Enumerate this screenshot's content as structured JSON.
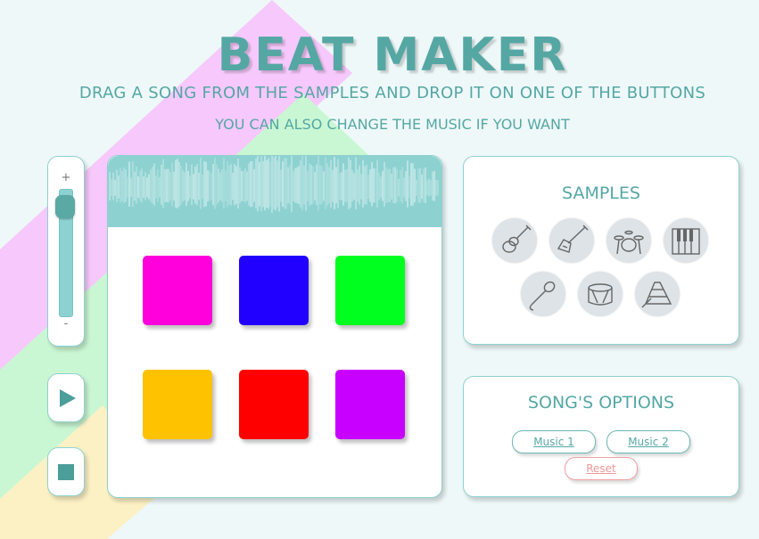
{
  "header": {
    "title": "BEAT MAKER",
    "subtitle": "DRAG A SONG FROM THE SAMPLES AND DROP IT ON ONE OF THE BUTTONS",
    "subtitle2": "YOU CAN ALSO CHANGE THE MUSIC IF YOU WANT"
  },
  "volume": {
    "plus": "+",
    "minus": "-",
    "level": 0.92
  },
  "controls": {
    "play_icon": "play-icon",
    "stop_icon": "stop-icon"
  },
  "pads": [
    {
      "color": "#ff00dd"
    },
    {
      "color": "#2200ff"
    },
    {
      "color": "#00ff1e"
    },
    {
      "color": "#ffc200"
    },
    {
      "color": "#ff0000"
    },
    {
      "color": "#c800ff"
    }
  ],
  "samples": {
    "title": "SAMPLES",
    "items": [
      {
        "icon": "acoustic-guitar-icon"
      },
      {
        "icon": "electric-guitar-icon"
      },
      {
        "icon": "drum-kit-icon"
      },
      {
        "icon": "piano-icon"
      },
      {
        "icon": "microphone-icon"
      },
      {
        "icon": "bass-drum-icon"
      },
      {
        "icon": "xylophone-icon"
      }
    ]
  },
  "options": {
    "title": "SONG'S OPTIONS",
    "music1": "Music 1",
    "music2": "Music 2",
    "reset": "Reset"
  },
  "colors": {
    "accent": "#55a7a4",
    "wave": "#8dd2d1",
    "reset": "#ee9898"
  }
}
